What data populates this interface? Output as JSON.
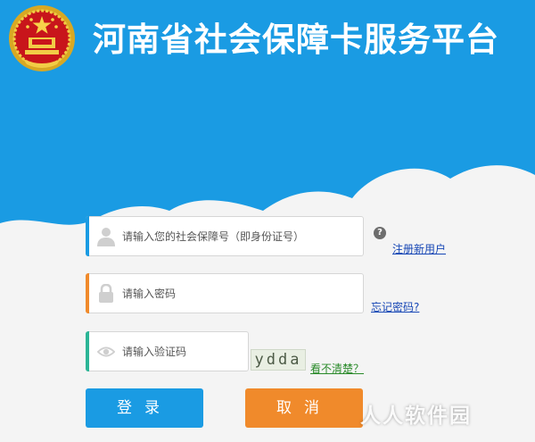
{
  "header": {
    "title": "河南省社会保障卡服务平台",
    "emblem_icon": "national-emblem-icon"
  },
  "form": {
    "username": {
      "placeholder": "请输入您的社会保障号（即身份证号）",
      "icon": "user-icon",
      "accent": "#1a9be3"
    },
    "password": {
      "placeholder": "请输入密码",
      "icon": "lock-icon",
      "accent": "#f08a2b"
    },
    "captcha": {
      "placeholder": "请输入验证码",
      "icon": "eye-icon",
      "accent": "#2bb596",
      "image_text": "ydda"
    },
    "help_symbol": "?",
    "register_link": "注册新用户",
    "forgot_link": "忘记密码?",
    "unclear_link": "看不清楚？"
  },
  "buttons": {
    "login": "登录",
    "cancel": "取消"
  },
  "watermark": "人人软件园",
  "colors": {
    "sky": "#1a9be3",
    "orange": "#f08a2b",
    "green": "#2bb596",
    "background": "#f4f4f4"
  }
}
